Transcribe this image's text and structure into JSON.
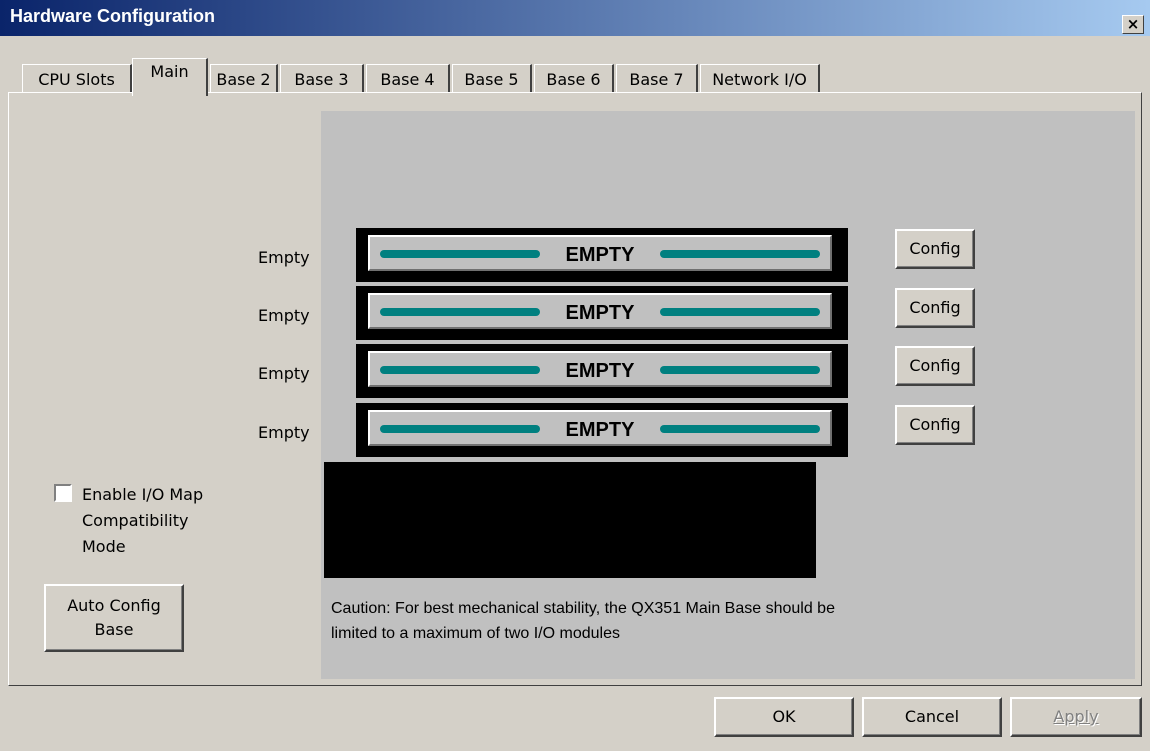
{
  "window": {
    "title": "Hardware Configuration",
    "close_glyph": "×"
  },
  "tabs": [
    {
      "label": "CPU Slots",
      "active": false
    },
    {
      "label": "Main",
      "active": true
    },
    {
      "label": "Base 2",
      "active": false
    },
    {
      "label": "Base 3",
      "active": false
    },
    {
      "label": "Base 4",
      "active": false
    },
    {
      "label": "Base 5",
      "active": false
    },
    {
      "label": "Base 6",
      "active": false
    },
    {
      "label": "Base 7",
      "active": false
    },
    {
      "label": "Network I/O",
      "active": false
    }
  ],
  "slots": [
    {
      "label": "Empty",
      "module": "EMPTY",
      "button": "Config"
    },
    {
      "label": "Empty",
      "module": "EMPTY",
      "button": "Config"
    },
    {
      "label": "Empty",
      "module": "EMPTY",
      "button": "Config"
    },
    {
      "label": "Empty",
      "module": "EMPTY",
      "button": "Config"
    }
  ],
  "compat": {
    "label_line1": "Enable I/O Map",
    "label_line2": "Compatibility",
    "label_line3": "Mode",
    "checked": false
  },
  "auto_config": {
    "line1": "Auto Config",
    "line2": "Base"
  },
  "caution": {
    "line1": "Caution: For best mechanical stability, the QX351 Main Base should be",
    "line2": "limited to a maximum of two I/O modules"
  },
  "dialog_buttons": {
    "ok": "OK",
    "cancel": "Cancel",
    "apply": "Apply"
  },
  "colors": {
    "title_start": "#0a246a",
    "title_end": "#a6caf0",
    "slot_bar": "#008080",
    "face": "#d4d0c8"
  }
}
